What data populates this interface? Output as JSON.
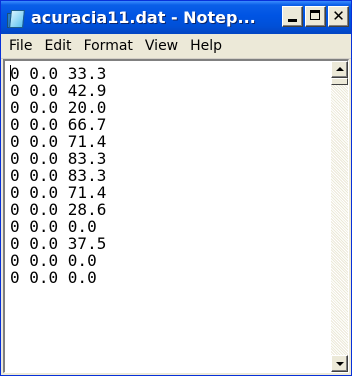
{
  "window": {
    "title": "acuracia11.dat - Notep...",
    "icon": "notepad-icon",
    "controls": {
      "minimize_icon": "minimize-icon",
      "maximize_icon": "maximize-icon",
      "close_label": "✕"
    }
  },
  "menu": {
    "items": [
      "File",
      "Edit",
      "Format",
      "View",
      "Help"
    ]
  },
  "editor": {
    "content": "0 0.0 33.3\n0 0.0 42.9\n0 0.0 20.0\n0 0.0 66.7\n0 0.0 71.4\n0 0.0 83.3\n0 0.0 83.3\n0 0.0 71.4\n0 0.0 28.6\n0 0.0 0.0\n0 0.0 37.5\n0 0.0 0.0\n0 0.0 0.0"
  },
  "colors": {
    "titlebar": "#0054e3",
    "title_text": "#ffffff",
    "chrome": "#ece9d8",
    "editor_bg": "#ffffff"
  }
}
